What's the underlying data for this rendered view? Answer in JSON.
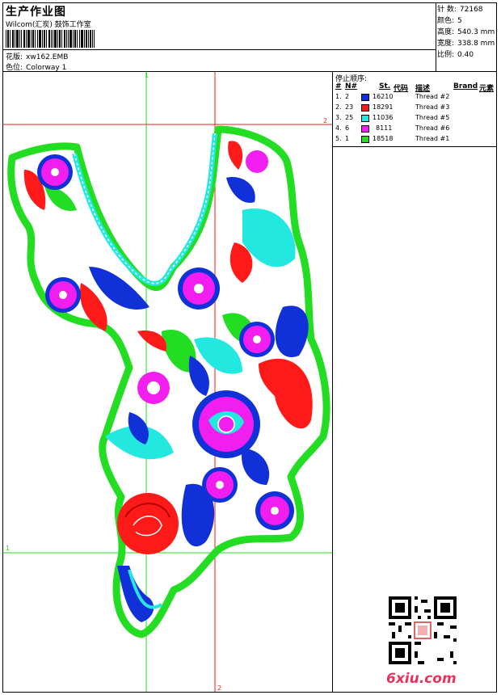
{
  "header": {
    "title": "生产作业图",
    "company": "Wilcom(汇炭) 鼓饰工作室",
    "design_label": "花版:",
    "design_value": "xw162.EMB",
    "color_label": "色位:",
    "color_value": "Colorway 1"
  },
  "stats": {
    "stitches_label": "针 数:",
    "stitches_value": "72168",
    "colors_label": "颜色:",
    "colors_value": "5",
    "height_label": "高度:",
    "height_value": "540.3 mm",
    "width_label": "宽度:",
    "width_value": "338.8 mm",
    "scale_label": "比例:",
    "scale_value": "0.40"
  },
  "sequence": {
    "caption": "停止顺序:",
    "headers": {
      "num": "#",
      "n": "N#",
      "st": "St.",
      "code": "代码",
      "desc": "描述",
      "brand": "Brand",
      "element": "元素"
    },
    "rows": [
      {
        "num": "1.",
        "n": "2",
        "color": "#1030d8",
        "code": "16210",
        "desc": "Thread #2"
      },
      {
        "num": "2.",
        "n": "23",
        "color": "#ff1a1a",
        "code": "18291",
        "desc": "Thread #3"
      },
      {
        "num": "3.",
        "n": "25",
        "color": "#22e8e0",
        "code": "11036",
        "desc": "Thread #5"
      },
      {
        "num": "4.",
        "n": "6",
        "color": "#f21ef0",
        "code": "8111",
        "desc": "Thread #6"
      },
      {
        "num": "5.",
        "n": "1",
        "color": "#22dd22",
        "code": "18518",
        "desc": "Thread #1"
      }
    ]
  },
  "guides": {
    "v1": "1",
    "h2": "2",
    "h1": "1",
    "v2": "2"
  },
  "footer": {
    "site": "6xiu.com"
  },
  "colors": {
    "green": "#22dd22",
    "red": "#ff1a1a",
    "cyan": "#22e8e0",
    "blue": "#1030d8",
    "magenta": "#f21ef0"
  }
}
